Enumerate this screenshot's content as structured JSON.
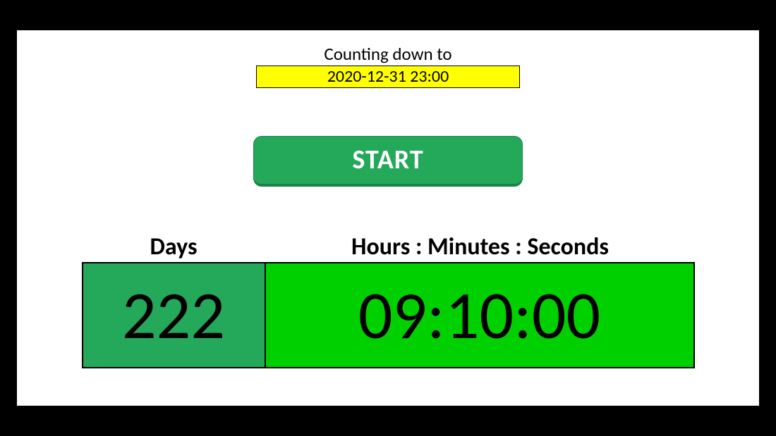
{
  "header": {
    "caption": "Counting down to",
    "target_datetime": "2020-12-31 23:00"
  },
  "start_button_label": "START",
  "labels": {
    "days": "Days",
    "hms": "Hours : Minutes : Seconds"
  },
  "countdown": {
    "days": "222",
    "hms": "09:10:00"
  }
}
